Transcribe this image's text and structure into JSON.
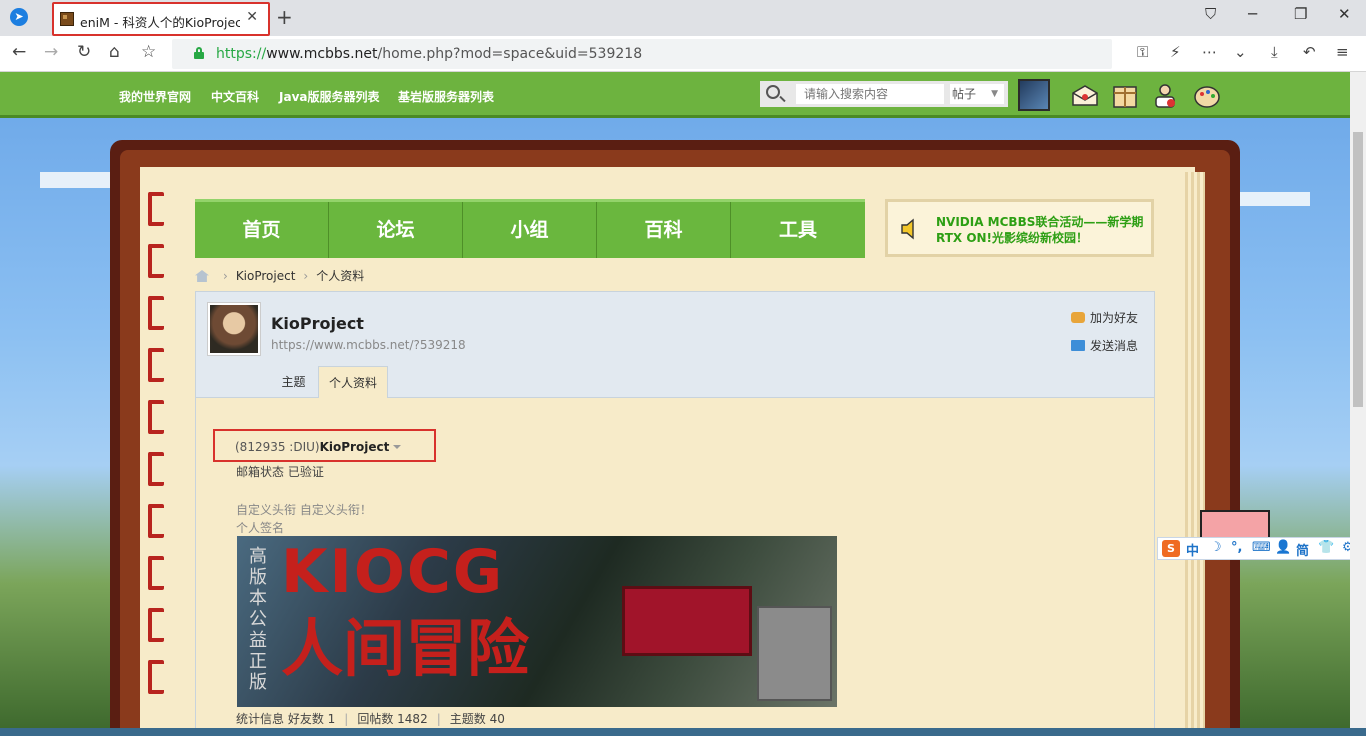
{
  "browser": {
    "tab_title": "eniM - 科资人个的KioProject",
    "tab_close": "✕",
    "new_tab": "+",
    "url_scheme": "https://",
    "url_host": "www.mcbbs.net",
    "url_path": "/home.php?mod=space&uid=539218",
    "window_controls": [
      "─",
      "❐",
      "✕"
    ]
  },
  "topnav": {
    "links": [
      "我的世界官网",
      "中文百科",
      "Java版服务器列表",
      "基岩版服务器列表"
    ],
    "search_placeholder": "请输入搜索内容",
    "search_type": "帖子"
  },
  "mainnav": [
    "首页",
    "论坛",
    "小组",
    "百科",
    "工具"
  ],
  "notice": "NVIDIA MCBBS联合活动——新学期RTX ON!光影缤纷新校园！",
  "breadcrumb": {
    "items": [
      "KioProject",
      "个人资料"
    ],
    "separator": "›"
  },
  "profile": {
    "name": "KioProject",
    "url": "https://www.mcbbs.net/?539218",
    "add_friend": "加为好友",
    "send_message": "发送消息",
    "tabs": [
      "主题",
      "个人资料"
    ],
    "uid_prefix": "(812935 :DIU)",
    "uid_name": "KioProject",
    "email_status": "邮箱状态   已验证",
    "custom_title": "自定义头衔   自定义头衔！",
    "signature_label": "个人签名",
    "banner_side": [
      "高",
      "版",
      "本",
      "公",
      "益",
      "正",
      "版"
    ],
    "banner_title": "KIOCG",
    "banner_sub": "人间冒险",
    "stats_label": "统计信息",
    "stats": [
      "好友数 1",
      "回帖数 1482",
      "主题数 40"
    ]
  },
  "ime": [
    "中",
    "☽",
    "°,",
    "⌨",
    "👤",
    "简",
    "👕",
    "⚙"
  ],
  "colors": {
    "accent_green": "#6ab73e",
    "notice_green": "#2d9f14",
    "highlight_red": "#d8322c"
  }
}
